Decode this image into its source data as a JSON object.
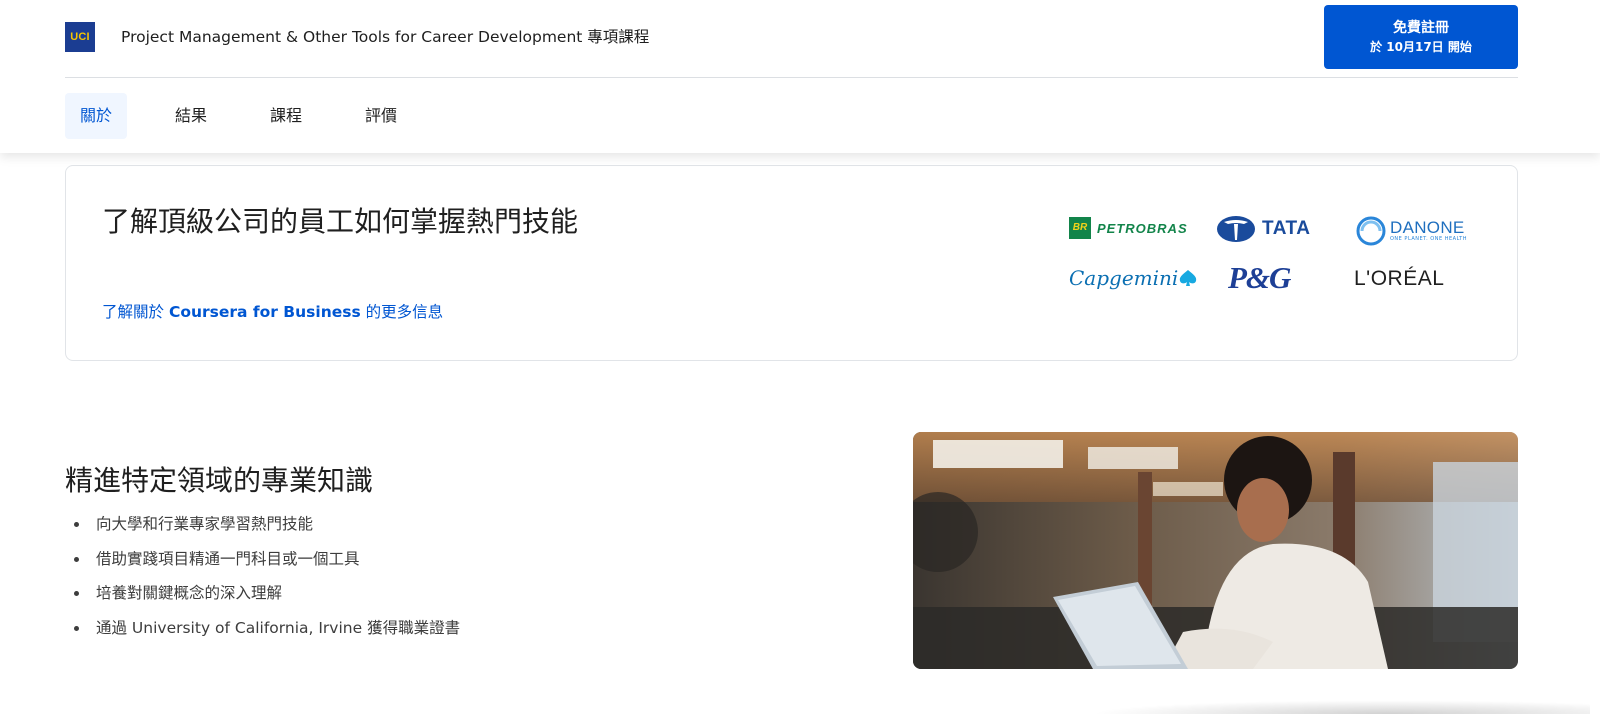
{
  "header": {
    "logo_text": "UCI",
    "program_title": "Project Management & Other Tools for Career Development 專項課程",
    "enroll_button": {
      "label": "免費註冊",
      "sublabel": "於 10月17日 開始"
    },
    "tabs": [
      {
        "label": "關於",
        "active": true
      },
      {
        "label": "結果",
        "active": false
      },
      {
        "label": "課程",
        "active": false
      },
      {
        "label": "評價",
        "active": false
      }
    ]
  },
  "business": {
    "heading": "了解頂級公司的員工如何掌握熱門技能",
    "link_prefix": "了解關於 ",
    "link_brand": "Coursera for Business",
    "link_suffix": " 的更多信息",
    "logos": [
      {
        "name": "petrobras-logo",
        "badge": "BR",
        "text": "PETROBRAS"
      },
      {
        "name": "tata-logo",
        "text": "TATA"
      },
      {
        "name": "danone-logo",
        "text": "DANONE",
        "tagline": "ONE PLANET. ONE HEALTH"
      },
      {
        "name": "capgemini-logo",
        "text": "Capgemini"
      },
      {
        "name": "pg-logo",
        "text": "P&G"
      },
      {
        "name": "loreal-logo",
        "text": "L'ORÉAL"
      }
    ]
  },
  "expertise": {
    "heading": "精進特定領域的專業知識",
    "bullets": [
      "向大學和行業專家學習熱門技能",
      "借助實踐項目精通一門科目或一個工具",
      "培養對關鍵概念的深入理解",
      "通過 University of California, Irvine 獲得職業證書"
    ]
  },
  "colors": {
    "primary": "#0056d2",
    "tab_active_bg": "#f0f6ff",
    "text": "#1f1f1f",
    "border": "#e1e4e8"
  }
}
